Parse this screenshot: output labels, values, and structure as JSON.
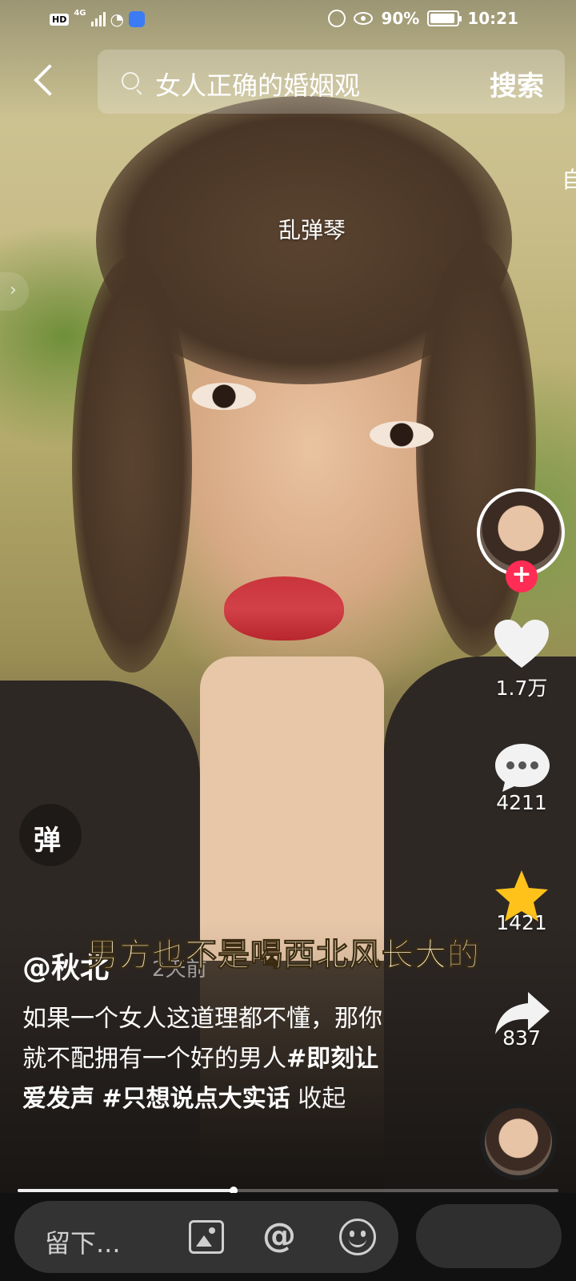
{
  "status_bar": {
    "network": "4G",
    "battery": "90%",
    "time": "10:21"
  },
  "search": {
    "query": "女人正确的婚姻观",
    "button_label": "搜索"
  },
  "peek_text": "自",
  "danmaku_sample": "乱弹琴",
  "rail": {
    "likes": "1.7万",
    "comments": "4211",
    "favorites": "1421",
    "shares": "837",
    "follow_symbol": "+"
  },
  "danmaku_toggle": "弹",
  "video_subtitle": "男方也不是喝西北风长大的",
  "author": "@秋北",
  "time_ago": "2天前",
  "description": {
    "text": "如果一个女人这道理都不懂，那你就不配拥有一个好的男人",
    "tag1": "#即刻让爱发声",
    "tag2": "#只想说点大实话",
    "fold": "收起"
  },
  "progress": {
    "fraction": 0.4
  },
  "comment_input": {
    "placeholder": "留下..."
  },
  "colors": {
    "follow": "#ff2c55",
    "favorite_star": "#ffc21a",
    "subtitle_text": "#fffbdf"
  }
}
